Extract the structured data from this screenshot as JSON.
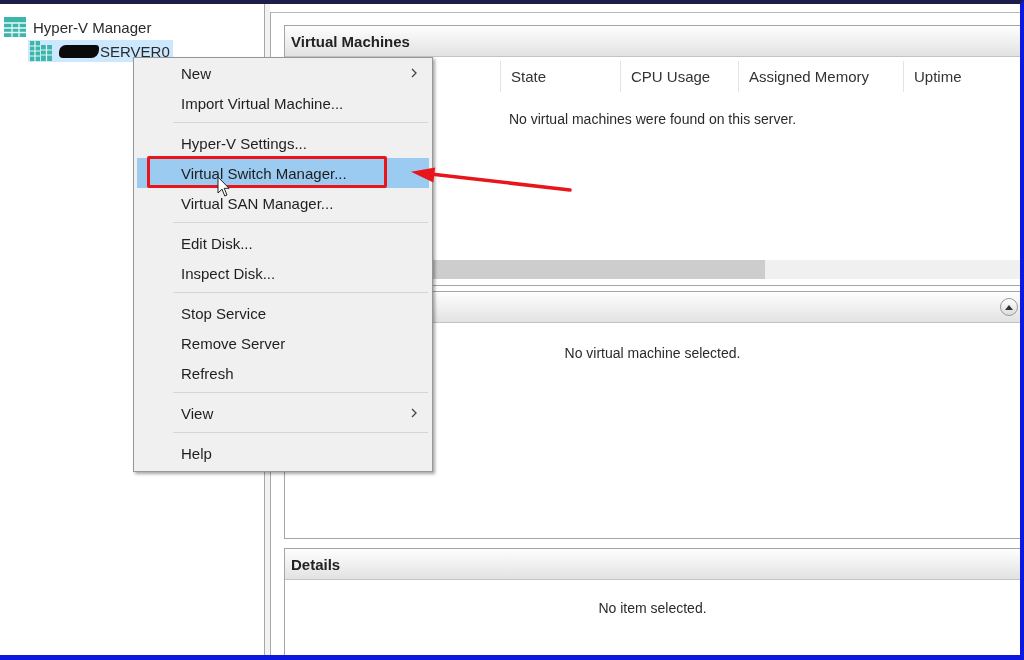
{
  "tree": [
    {
      "kind": "manager",
      "label": "Hyper-V Manager",
      "selected": false,
      "redacted": false,
      "children": [
        {
          "kind": "server",
          "label": "SERVER0",
          "selected": true,
          "redacted": true
        }
      ]
    }
  ],
  "virtual_machines": {
    "title": "Virtual Machines",
    "columns": [
      "State",
      "CPU Usage",
      "Assigned Memory",
      "Uptime"
    ],
    "empty_message": "No virtual machines were found on this server."
  },
  "panel_2": {
    "expanded": true,
    "empty_message": "No virtual machine selected."
  },
  "details": {
    "title": "Details",
    "empty_message": "No item selected."
  },
  "context_menu": {
    "pointer_shown": true,
    "groups": [
      {
        "items": [
          {
            "label": "New",
            "submenu": true,
            "selected": false,
            "annotated": false
          },
          {
            "label": "Import Virtual Machine...",
            "submenu": false,
            "selected": false,
            "annotated": false
          }
        ]
      },
      {
        "items": [
          {
            "label": "Hyper-V Settings...",
            "submenu": false,
            "selected": false,
            "annotated": false
          },
          {
            "label": "Virtual Switch Manager...",
            "submenu": false,
            "selected": true,
            "annotated": true
          },
          {
            "label": "Virtual SAN Manager...",
            "submenu": false,
            "selected": false,
            "annotated": false
          }
        ]
      },
      {
        "items": [
          {
            "label": "Edit Disk...",
            "submenu": false,
            "selected": false,
            "annotated": false
          },
          {
            "label": "Inspect Disk...",
            "submenu": false,
            "selected": false,
            "annotated": false
          }
        ]
      },
      {
        "items": [
          {
            "label": "Stop Service",
            "submenu": false,
            "selected": false,
            "annotated": false
          },
          {
            "label": "Remove Server",
            "submenu": false,
            "selected": false,
            "annotated": false
          },
          {
            "label": "Refresh",
            "submenu": false,
            "selected": false,
            "annotated": false
          }
        ]
      },
      {
        "items": [
          {
            "label": "View",
            "submenu": true,
            "selected": false,
            "annotated": false
          }
        ]
      },
      {
        "items": [
          {
            "label": "Help",
            "submenu": false,
            "selected": false,
            "annotated": false
          }
        ]
      }
    ]
  }
}
